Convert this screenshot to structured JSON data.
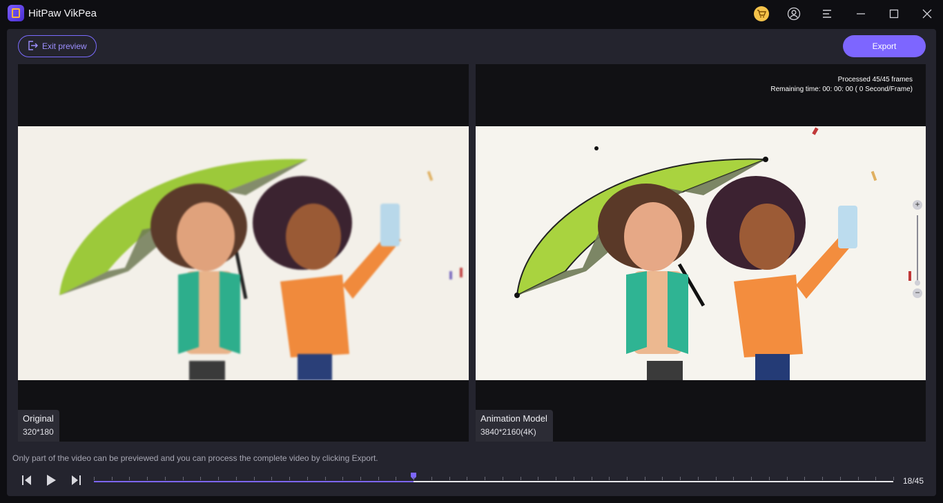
{
  "app": {
    "title": "HitPaw VikPea"
  },
  "titlebar_icons": [
    "cart-icon",
    "user-icon",
    "menu-icon",
    "minimize-icon",
    "maximize-icon",
    "close-icon"
  ],
  "toolbar": {
    "exit_label": "Exit preview",
    "export_label": "Export"
  },
  "left_pane": {
    "title": "Original",
    "resolution": "320*180"
  },
  "right_pane": {
    "title": "Animation Model",
    "resolution": "3840*2160(4K)",
    "processed": "Processed 45/45 frames",
    "remaining": "Remaining time: 00: 00: 00 ( 0 Second/Frame)"
  },
  "zoom": {
    "plus": "+",
    "minus": "−",
    "level": 0.05
  },
  "notice": "Only part of the video can be previewed and you can process the complete video by clicking Export.",
  "player": {
    "current_frame": 18,
    "total_frames": 45,
    "frame_label": "18/45"
  },
  "colors": {
    "accent": "#7d66ff",
    "panel": "#24242e",
    "background": "#0e0e12"
  }
}
